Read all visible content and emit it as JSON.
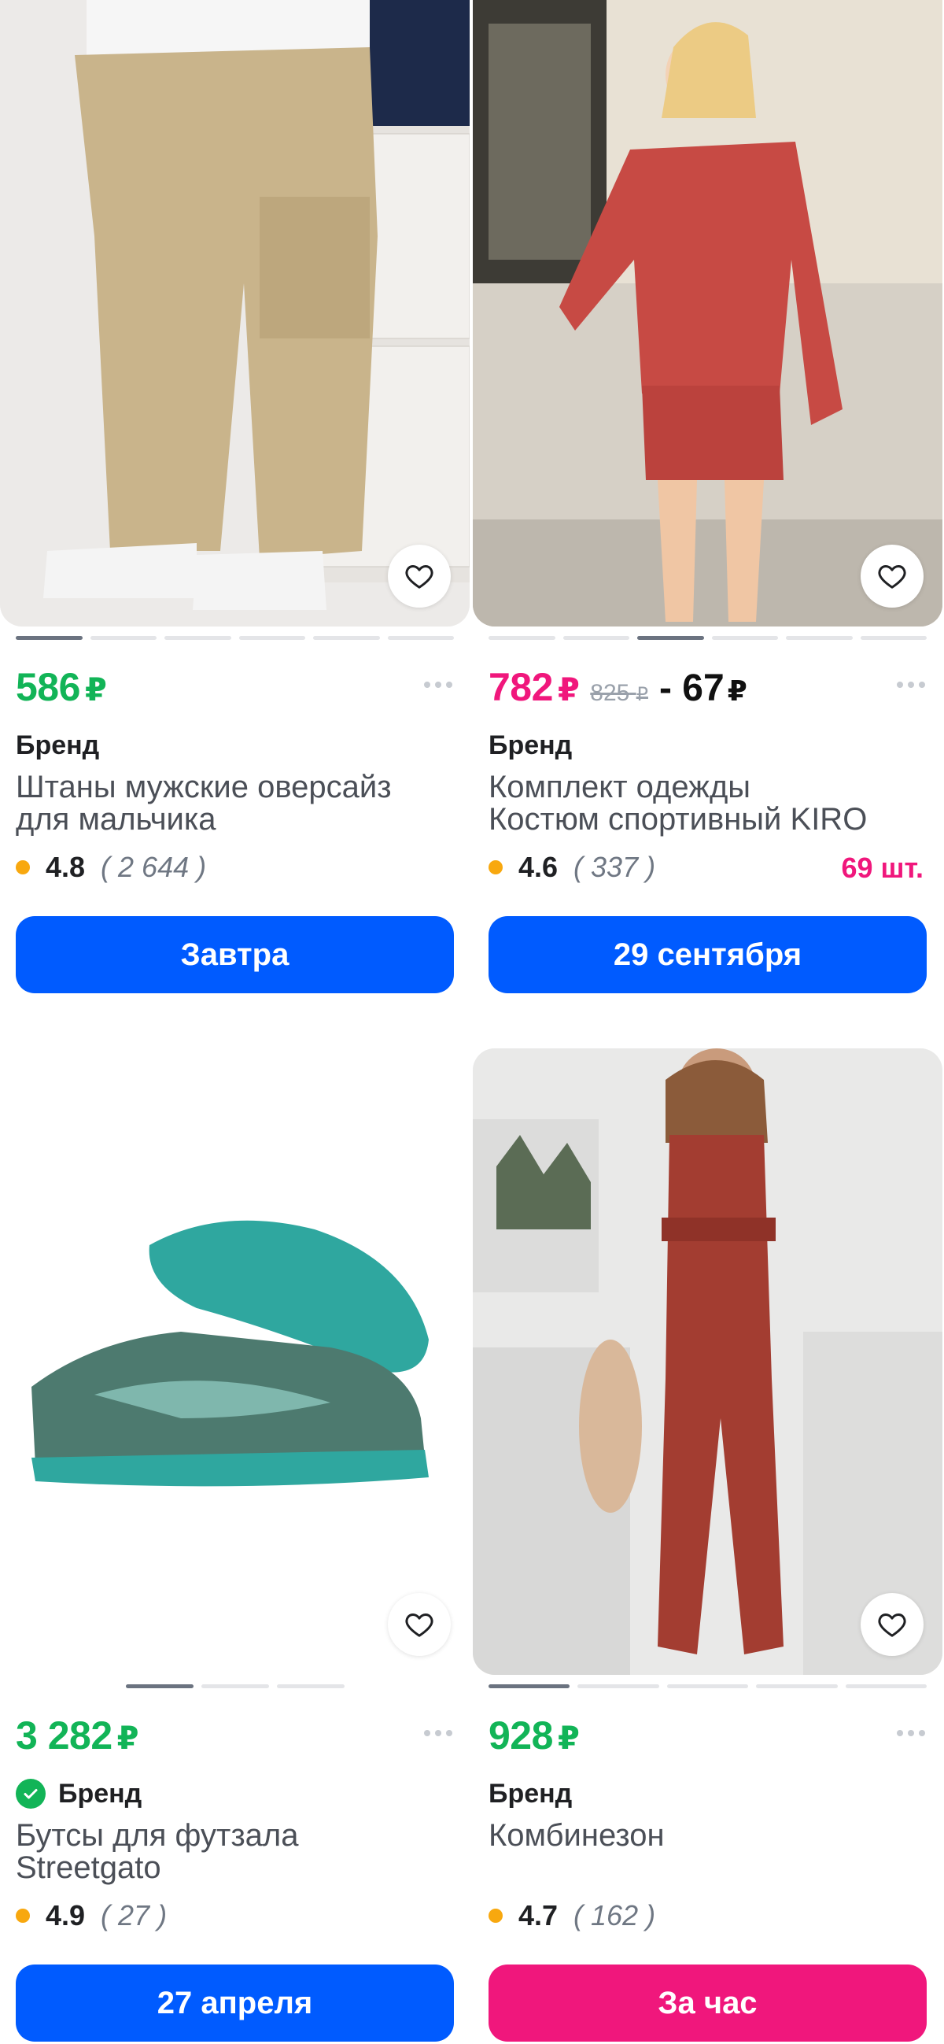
{
  "colors": {
    "price_green": "#12b457",
    "price_pink": "#f0177c",
    "button_blue": "#005bff",
    "button_pink": "#f0177c",
    "rating_dot": "#f8a80f"
  },
  "products": [
    {
      "price": "586",
      "currency": "₽",
      "brand": "Бренд",
      "title_line1": "Штаны мужские оверсайз",
      "title_line2": "для мальчика",
      "rating": "4.8",
      "reviews": "( 2 644 )",
      "button": "Завтра",
      "favorite_icon": "heart-outline-icon"
    },
    {
      "price": "782",
      "currency": "₽",
      "old_price": "825",
      "old_currency": "₽",
      "discount": "- 67",
      "discount_currency": "₽",
      "brand": "Бренд",
      "title_line1": "Комплект одежды",
      "title_line2": "Костюм спортивный KIRO",
      "rating": "4.6",
      "reviews": "( 337 )",
      "stock": "69 шт.",
      "button": "29 сентября",
      "favorite_icon": "heart-outline-icon"
    },
    {
      "price": "3 282",
      "currency": "₽",
      "brand": "Бренд",
      "brand_verified": true,
      "title_line1": "Бутсы для футзала",
      "title_line2": "Streetgato",
      "rating": "4.9",
      "reviews": "( 27 )",
      "button": "27 апреля",
      "favorite_icon": "heart-outline-icon"
    },
    {
      "price": "928",
      "currency": "₽",
      "brand": "Бренд",
      "title_line1": "Комбинезон",
      "title_line2": "",
      "rating": "4.7",
      "reviews": "( 162 )",
      "button": "За час",
      "favorite_icon": "heart-outline-icon"
    }
  ]
}
